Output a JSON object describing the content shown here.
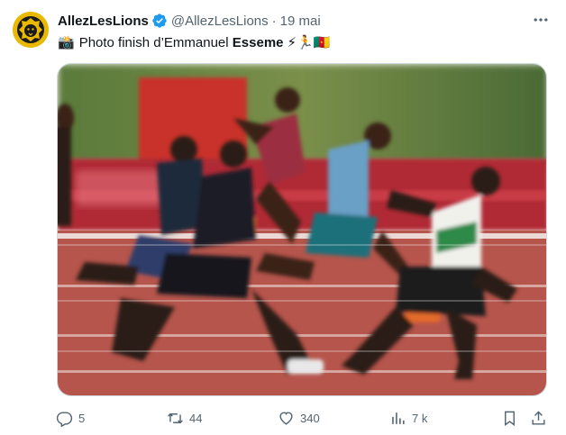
{
  "tweet": {
    "display_name": "AllezLesLions",
    "handle": "@AllezLesLions",
    "separator": "·",
    "date": "19 mai",
    "text_prefix_emoji": "📸",
    "text_before": "Photo finish d’Emmanuel ",
    "text_bold": "Esseme",
    "text_emojis": "⚡🏃🇨🇲"
  },
  "media": {
    "description_icon": "photo-icon"
  },
  "actions": {
    "replies": "5",
    "retweets": "44",
    "likes": "340",
    "views": "7 k"
  },
  "colors": {
    "verified": "#1d9bf0",
    "text_secondary": "#536471",
    "avatar_bg": "#e9b800",
    "track": "#b5554c"
  }
}
